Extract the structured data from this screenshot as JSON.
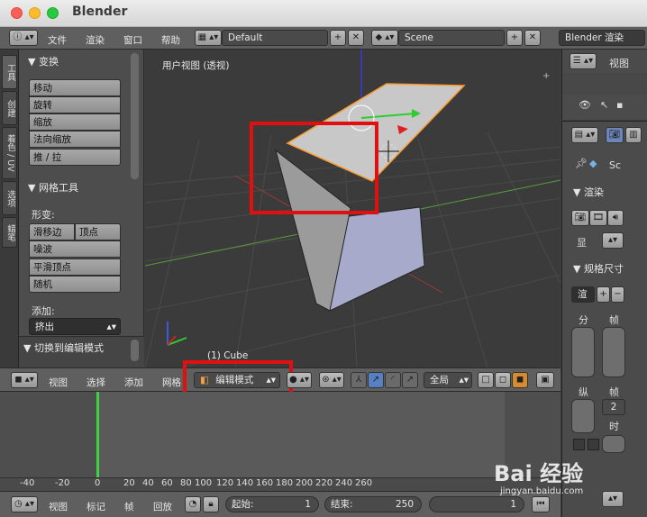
{
  "window": {
    "title": "Blender"
  },
  "topbar": {
    "menus": [
      "文件",
      "渲染",
      "窗口",
      "帮助"
    ],
    "layout": "Default",
    "scene": "Scene",
    "engine": "Blender 渲染"
  },
  "tool_tabs": [
    "工具",
    "创建",
    "着色 / UV",
    "选项",
    "蜡笔"
  ],
  "tools": {
    "transform_header": "▼ 变换",
    "transform_buttons": [
      "移动",
      "旋转",
      "缩放",
      "法向缩放",
      "推 / 拉"
    ],
    "mesh_header": "▼ 网格工具",
    "deform_label": "形变:",
    "slide_edge": "滑移边",
    "vertex": "顶点",
    "noise": "噪波",
    "smooth_vertex": "平滑顶点",
    "random": "随机",
    "add_label": "添加:",
    "extrude": "挤出",
    "toggle_edit": "▼ 切换到编辑模式"
  },
  "viewport": {
    "view_label": "用户视图 (透视)",
    "object_label": "(1) Cube"
  },
  "view_header": {
    "menus": [
      "视图",
      "选择",
      "添加",
      "网格"
    ],
    "mode": "编辑模式",
    "pivot": "全局"
  },
  "timeline": {
    "ticks": [
      "-40",
      "-20",
      "0",
      "20",
      "40",
      "60",
      "80",
      "100",
      "120",
      "140",
      "160",
      "180",
      "200",
      "220",
      "240",
      "260"
    ],
    "menus": [
      "视图",
      "标记",
      "帧",
      "回放"
    ],
    "start_label": "起始:",
    "start_value": "1",
    "end_label": "结束:",
    "end_value": "250",
    "current": "1"
  },
  "outliner": {
    "view": "视图"
  },
  "properties": {
    "scene_short": "Sc",
    "render_header": "▼ 渲染",
    "display_label": "显",
    "dimensions_header": "▼ 规格尺寸",
    "render_preset": "渲",
    "resolution_label": "分",
    "frame_label": "帧",
    "aspect_label": "纵",
    "frame_label2": "帧",
    "frame_step": "2",
    "time_label": "时"
  },
  "watermark": {
    "main": "Bai 经验",
    "sub": "jingyan.baidu.com"
  }
}
